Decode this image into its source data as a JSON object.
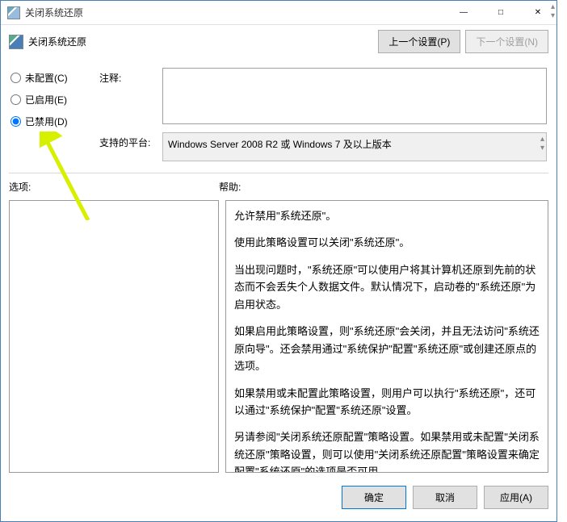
{
  "title": "关闭系统还原",
  "subtitle": "关闭系统还原",
  "nav": {
    "prev": "上一个设置(P)",
    "next": "下一个设置(N)"
  },
  "radios": {
    "not_configured": "未配置(C)",
    "enabled": "已启用(E)",
    "disabled": "已禁用(D)",
    "selected": "disabled"
  },
  "labels": {
    "comment": "注释:",
    "platform": "支持的平台:",
    "options": "选项:",
    "help": "帮助:"
  },
  "comment": "",
  "platform": "Windows Server 2008 R2 或 Windows 7 及以上版本",
  "help_paragraphs": [
    "允许禁用\"系统还原\"。",
    "使用此策略设置可以关闭\"系统还原\"。",
    "当出现问题时，\"系统还原\"可以使用户将其计算机还原到先前的状态而不会丢失个人数据文件。默认情况下，启动卷的\"系统还原\"为启用状态。",
    "如果启用此策略设置，则\"系统还原\"会关闭，并且无法访问\"系统还原向导\"。还会禁用通过\"系统保护\"配置\"系统还原\"或创建还原点的选项。",
    "如果禁用或未配置此策略设置，则用户可以执行\"系统还原\"，还可以通过\"系统保护\"配置\"系统还原\"设置。",
    "另请参阅\"关闭系统还原配置\"策略设置。如果禁用或未配置\"关闭系统还原\"策略设置，则可以使用\"关闭系统还原配置\"策略设置来确定配置\"系统还原\"的选项是否可用。"
  ],
  "buttons": {
    "ok": "确定",
    "cancel": "取消",
    "apply": "应用(A)"
  },
  "win": {
    "min": "—",
    "max": "□",
    "close": "✕"
  }
}
